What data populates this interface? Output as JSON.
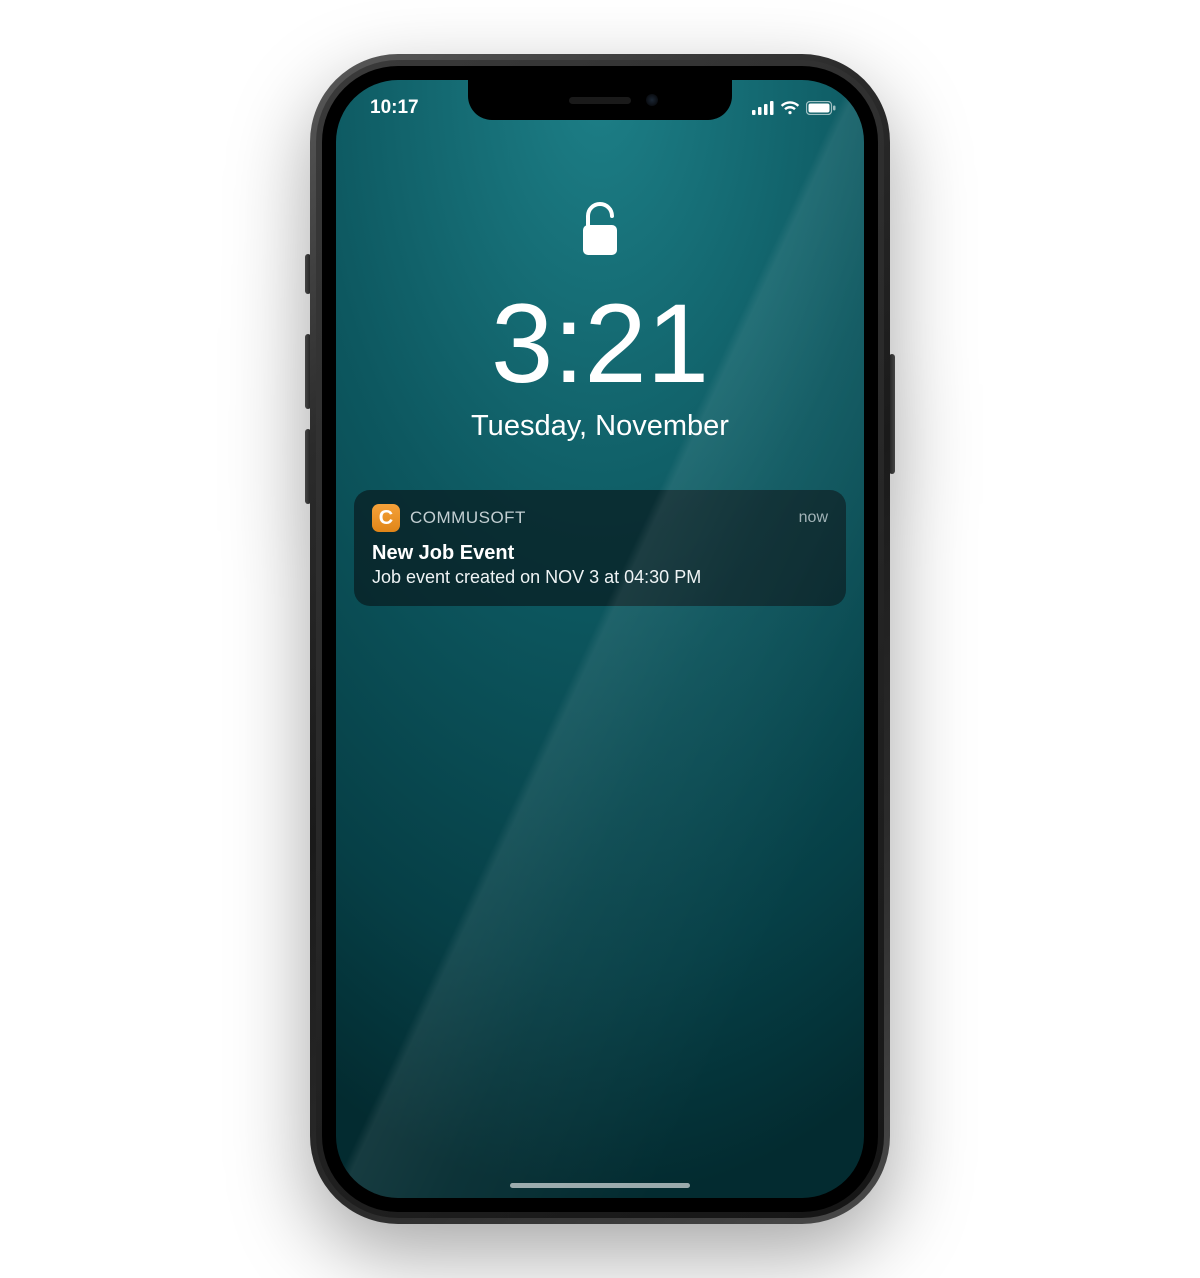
{
  "status": {
    "time": "10:17",
    "icons": {
      "signal": "signal-icon",
      "wifi": "wifi-icon",
      "battery": "battery-icon"
    }
  },
  "lockscreen": {
    "time": "3:21",
    "date": "Tuesday, November",
    "lock_state": "unlocked"
  },
  "notification": {
    "app_name": "COMMUSOFT",
    "app_icon_letter": "C",
    "timestamp": "now",
    "title": "New Job Event",
    "body": "Job event created on NOV 3 at 04:30 PM"
  },
  "colors": {
    "wallpaper_top": "#1d7f87",
    "wallpaper_bottom": "#032b30",
    "notif_bg": "rgba(8,28,32,0.72)",
    "app_icon_bg": "#e08518"
  }
}
